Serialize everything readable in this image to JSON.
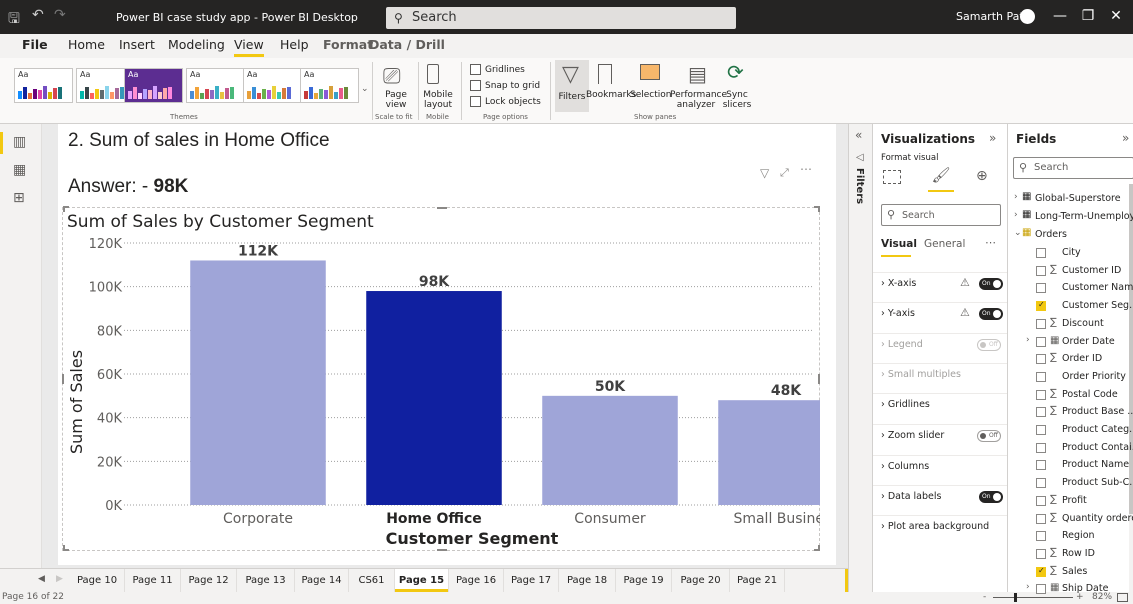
{
  "titlebar": {
    "title": "Power BI case study app - Power BI Desktop",
    "search_placeholder": "Search",
    "user_name": "Samarth Patil"
  },
  "menu": [
    "File",
    "Home",
    "Insert",
    "Modeling",
    "View",
    "Help",
    "Format",
    "Data / Drill"
  ],
  "ribbon": {
    "themes_label": "Themes",
    "page_view": "Page view",
    "scale_to_fit": "Scale to fit",
    "mobile_layout": "Mobile layout",
    "mobile": "Mobile",
    "gridlines": "Gridlines",
    "snap_to_grid": "Snap to grid",
    "lock_objects": "Lock objects",
    "page_options": "Page options",
    "filters": "Filters",
    "bookmarks": "Bookmarks",
    "selection": "Selection",
    "performance_analyzer": "Performance analyzer",
    "sync_slicers": "Sync slicers",
    "show_panes": "Show panes"
  },
  "report": {
    "heading": "2. Sum of sales in Home Office",
    "answer_prefix": "Answer: - ",
    "answer_value": "98K"
  },
  "chart_data": {
    "type": "bar",
    "title": "Sum of Sales by Customer Segment",
    "xlabel": "Customer Segment",
    "ylabel": "Sum of Sales",
    "categories": [
      "Corporate",
      "Home Office",
      "Consumer",
      "Small Business"
    ],
    "values": [
      112000,
      98000,
      50000,
      48000
    ],
    "data_labels": [
      "112K",
      "98K",
      "50K",
      "48K"
    ],
    "highlighted": "Home Office",
    "ylim": [
      0,
      120000
    ],
    "yticks": [
      "0K",
      "20K",
      "40K",
      "60K",
      "80K",
      "100K",
      "120K"
    ],
    "grid": true,
    "bar_color": "#9fa5d8",
    "highlight_color": "#1020a0"
  },
  "pages": [
    "Page 10",
    "Page 11",
    "Page 12",
    "Page 13",
    "Page 14",
    "CS61",
    "Page 15",
    "Page 16",
    "Page 17",
    "Page 18",
    "Page 19",
    "Page 20",
    "Page 21"
  ],
  "active_page": "Page 15",
  "status": {
    "page_count": "Page 16 of 22",
    "zoom": "82%"
  },
  "filters_label": "Filters",
  "viz_pane": {
    "title": "Visualizations",
    "format_visual": "Format visual",
    "search_placeholder": "Search",
    "tab_visual": "Visual",
    "tab_general": "General",
    "sections": [
      {
        "label": "X-axis",
        "toggle": "On",
        "warn": true
      },
      {
        "label": "Y-axis",
        "toggle": "On",
        "warn": true
      },
      {
        "label": "Legend",
        "toggle": "Off",
        "dim": true
      },
      {
        "label": "Small multiples",
        "toggle": "",
        "dim": true
      },
      {
        "label": "Gridlines",
        "toggle": ""
      },
      {
        "label": "Zoom slider",
        "toggle": "Off"
      },
      {
        "label": "Columns",
        "toggle": ""
      },
      {
        "label": "Data labels",
        "toggle": "On"
      },
      {
        "label": "Plot area background",
        "toggle": ""
      }
    ]
  },
  "fields_pane": {
    "title": "Fields",
    "search_placeholder": "Search",
    "tables": [
      "Global-Superstore",
      "Long-Term-Unemploy...",
      "Orders"
    ],
    "fields": [
      {
        "name": "City",
        "sigma": false,
        "checked": false
      },
      {
        "name": "Customer ID",
        "sigma": true,
        "checked": false
      },
      {
        "name": "Customer Name",
        "sigma": false,
        "checked": false
      },
      {
        "name": "Customer Seg...",
        "sigma": false,
        "checked": true
      },
      {
        "name": "Discount",
        "sigma": true,
        "checked": false
      },
      {
        "name": "Order Date",
        "sigma": false,
        "checked": false,
        "calendar": true,
        "expand": true
      },
      {
        "name": "Order ID",
        "sigma": true,
        "checked": false
      },
      {
        "name": "Order Priority",
        "sigma": false,
        "checked": false
      },
      {
        "name": "Postal Code",
        "sigma": true,
        "checked": false
      },
      {
        "name": "Product Base ...",
        "sigma": true,
        "checked": false
      },
      {
        "name": "Product Categ...",
        "sigma": false,
        "checked": false
      },
      {
        "name": "Product Contai...",
        "sigma": false,
        "checked": false
      },
      {
        "name": "Product Name",
        "sigma": false,
        "checked": false
      },
      {
        "name": "Product Sub-C...",
        "sigma": false,
        "checked": false
      },
      {
        "name": "Profit",
        "sigma": true,
        "checked": false
      },
      {
        "name": "Quantity ordered ...",
        "sigma": true,
        "checked": false
      },
      {
        "name": "Region",
        "sigma": false,
        "checked": false
      },
      {
        "name": "Row ID",
        "sigma": true,
        "checked": false
      },
      {
        "name": "Sales",
        "sigma": true,
        "checked": true
      },
      {
        "name": "Ship Date",
        "sigma": false,
        "checked": false,
        "calendar": true,
        "expand": true
      }
    ]
  }
}
